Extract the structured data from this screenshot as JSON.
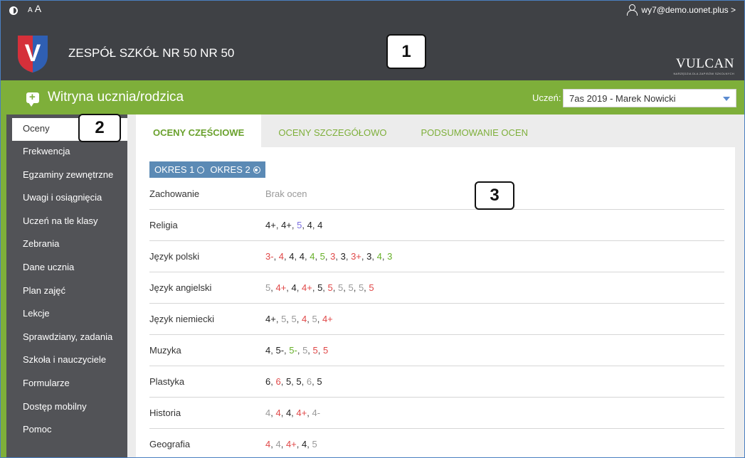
{
  "header": {
    "font_size_small": "A",
    "font_size_large": "A",
    "user_email": "wy7@demo.uonet.plus >",
    "school_name": "ZESPÓŁ SZKÓŁ NR 50 NR 50",
    "logo_letter": "V",
    "vulcan_word": "VULCAN",
    "vulcan_sub": "NARZĘDZIA DLA ZAPISÓW SZKOLNYCH"
  },
  "callouts": {
    "one": "1",
    "two": "2",
    "three": "3"
  },
  "greenbar": {
    "site_title": "Witryna ucznia/rodzica",
    "student_label": "Uczeń:",
    "student_value": "7as 2019 - Marek Nowicki"
  },
  "sidebar": {
    "items": [
      {
        "label": "Oceny"
      },
      {
        "label": "Frekwencja"
      },
      {
        "label": "Egzaminy zewnętrzne"
      },
      {
        "label": "Uwagi i osiągnięcia"
      },
      {
        "label": "Uczeń na tle klasy"
      },
      {
        "label": "Zebrania"
      },
      {
        "label": "Dane ucznia"
      },
      {
        "label": "Plan zajęć"
      },
      {
        "label": "Lekcje"
      },
      {
        "label": "Sprawdziany, zadania"
      },
      {
        "label": "Szkoła i nauczyciele"
      },
      {
        "label": "Formularze"
      },
      {
        "label": "Dostęp mobilny"
      },
      {
        "label": "Pomoc"
      }
    ]
  },
  "tabs": [
    {
      "label": "OCENY CZĘŚCIOWE"
    },
    {
      "label": "OCENY SZCZEGÓŁOWO"
    },
    {
      "label": "PODSUMOWANIE OCEN"
    }
  ],
  "periods": [
    {
      "label": "OKRES 1",
      "selected": false
    },
    {
      "label": "OKRES 2",
      "selected": true
    }
  ],
  "colors": {
    "green": "#7eaf3a",
    "dark": "#3f4145",
    "sidebar": "#525357",
    "period_bar": "#5b8ab5",
    "red_grade": "#e04848",
    "green_grade": "#67b029"
  },
  "grades": [
    {
      "subject": "Zachowanie",
      "empty_text": "Brak ocen",
      "values": []
    },
    {
      "subject": "Religia",
      "values": [
        {
          "v": "4+",
          "c": "blk"
        },
        {
          "v": "4+",
          "c": "blk"
        },
        {
          "v": "5",
          "c": "purple"
        },
        {
          "v": "4",
          "c": "blk"
        },
        {
          "v": "4",
          "c": "blk"
        }
      ]
    },
    {
      "subject": "Język polski",
      "values": [
        {
          "v": "3-",
          "c": "red"
        },
        {
          "v": "4",
          "c": "red"
        },
        {
          "v": "4",
          "c": "blk"
        },
        {
          "v": "4",
          "c": "blk"
        },
        {
          "v": "4",
          "c": "green"
        },
        {
          "v": "5",
          "c": "green"
        },
        {
          "v": "3",
          "c": "red"
        },
        {
          "v": "3",
          "c": "blk"
        },
        {
          "v": "3+",
          "c": "red"
        },
        {
          "v": "3",
          "c": "blk"
        },
        {
          "v": "4",
          "c": "green"
        },
        {
          "v": "3",
          "c": "green"
        }
      ]
    },
    {
      "subject": "Język angielski",
      "values": [
        {
          "v": "5",
          "c": "gray"
        },
        {
          "v": "4+",
          "c": "red"
        },
        {
          "v": "4",
          "c": "blk"
        },
        {
          "v": "4+",
          "c": "red"
        },
        {
          "v": "5",
          "c": "blk"
        },
        {
          "v": "5",
          "c": "red"
        },
        {
          "v": "5",
          "c": "gray"
        },
        {
          "v": "5",
          "c": "gray"
        },
        {
          "v": "5",
          "c": "gray"
        },
        {
          "v": "5",
          "c": "red"
        }
      ]
    },
    {
      "subject": "Język niemiecki",
      "values": [
        {
          "v": "4+",
          "c": "blk"
        },
        {
          "v": "5",
          "c": "gray"
        },
        {
          "v": "5",
          "c": "gray"
        },
        {
          "v": "4",
          "c": "red"
        },
        {
          "v": "5",
          "c": "gray"
        },
        {
          "v": "4+",
          "c": "red"
        }
      ]
    },
    {
      "subject": "Muzyka",
      "values": [
        {
          "v": "4",
          "c": "blk"
        },
        {
          "v": "5-",
          "c": "blk"
        },
        {
          "v": "5-",
          "c": "green"
        },
        {
          "v": "5",
          "c": "gray"
        },
        {
          "v": "5",
          "c": "red"
        },
        {
          "v": "5",
          "c": "red"
        }
      ]
    },
    {
      "subject": "Plastyka",
      "values": [
        {
          "v": "6",
          "c": "blk"
        },
        {
          "v": "6",
          "c": "red"
        },
        {
          "v": "5",
          "c": "blk"
        },
        {
          "v": "5",
          "c": "blk"
        },
        {
          "v": "6",
          "c": "gray"
        },
        {
          "v": "5",
          "c": "blk"
        }
      ]
    },
    {
      "subject": "Historia",
      "values": [
        {
          "v": "4",
          "c": "gray"
        },
        {
          "v": "4",
          "c": "red"
        },
        {
          "v": "4",
          "c": "blk"
        },
        {
          "v": "4+",
          "c": "red"
        },
        {
          "v": "4-",
          "c": "gray"
        }
      ]
    },
    {
      "subject": "Geografia",
      "values": [
        {
          "v": "4",
          "c": "red"
        },
        {
          "v": "4",
          "c": "gray"
        },
        {
          "v": "4+",
          "c": "red"
        },
        {
          "v": "4",
          "c": "blk"
        },
        {
          "v": "5",
          "c": "gray"
        }
      ]
    }
  ]
}
